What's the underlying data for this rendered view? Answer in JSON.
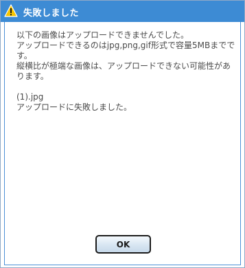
{
  "dialog": {
    "title": "失敗しました",
    "icon": "warning-icon",
    "message_lines": [
      "以下の画像はアップロードできませんでした。",
      "アップロードできるのはjpg,png,gif形式で容量5MBまでです。",
      "縦横比が極端な画像は、アップロードできない可能性があります。"
    ],
    "file_name": "(1).jpg",
    "file_status": "アップロードに失敗しました。",
    "ok_label": "OK"
  },
  "colors": {
    "titlebar": "#3d8bd4",
    "warning_yellow": "#f5c400",
    "border": "#4a8fd6"
  }
}
